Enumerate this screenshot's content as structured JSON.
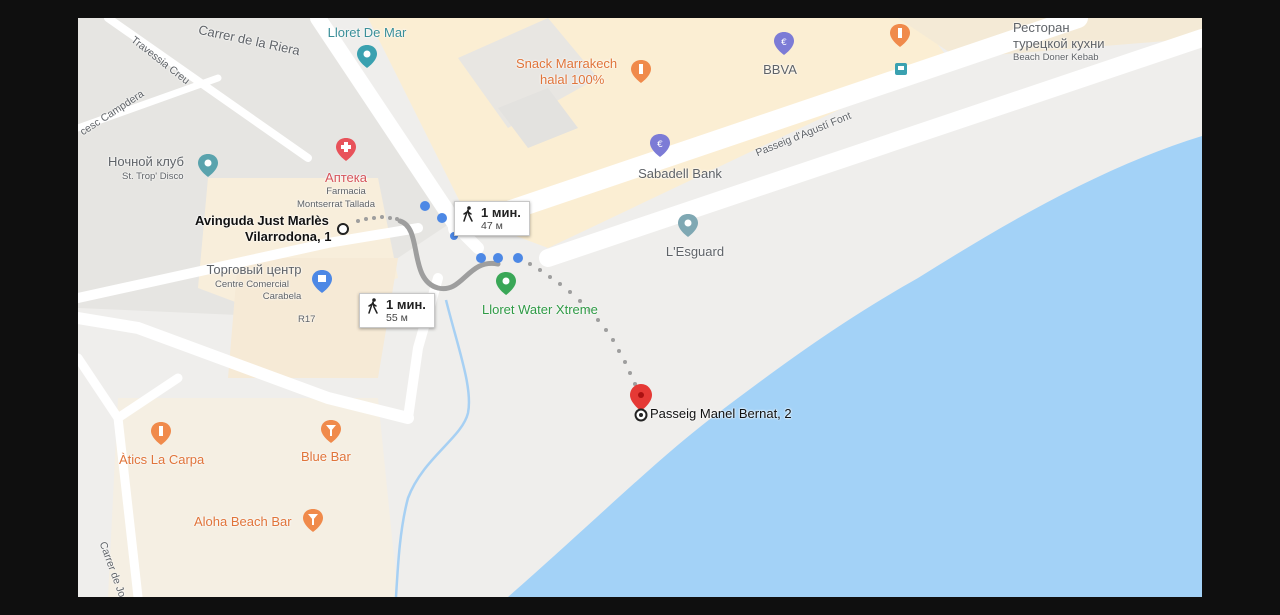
{
  "streets": {
    "carrer_de_la_riera": "Carrer de la Riera",
    "travessia_creu": "Travessia Creu",
    "cesc_campdera": "cesc Campdera",
    "passeig_agusti_font": "Passeig d'Agustí Font",
    "carrer_de_jo": "Carrer de Jo",
    "r17": "R17"
  },
  "places": {
    "lloret_de_mar": "Lloret De Mar",
    "snack_marrakech_line1": "Snack Marrakech",
    "snack_marrakech_line2": "halal 100%",
    "bbva": "BBVA",
    "restaurant_line1": "Ресторан",
    "restaurant_line2": "турецкой кухни",
    "restaurant_line3": "Beach Doner Kebab",
    "nightclub_line1": "Ночной клуб",
    "nightclub_line2": "St. Trop' Disco",
    "pharmacy_line1": "Аптека",
    "pharmacy_line2": "Farmacia",
    "pharmacy_line3": "Montserrat Tallada",
    "sabadell": "Sabadell Bank",
    "esguard": "L'Esguard",
    "mall_line1": "Торговый центр",
    "mall_line2": "Centre Comercial",
    "mall_line3": "Carabela",
    "water_xtreme": "Lloret Water Xtreme",
    "atics": "Àtics La Carpa",
    "blue_bar": "Blue Bar",
    "aloha": "Aloha Beach Bar"
  },
  "route": {
    "origin_line1": "Avinguda Just Marlès",
    "origin_line2": "Vilarrodona, 1",
    "destination": "Passeig Manel Bernat, 2",
    "callout_top": {
      "time": "1 мин.",
      "distance": "47 м"
    },
    "callout_bottom": {
      "time": "1 мин.",
      "distance": "55 м"
    }
  },
  "colors": {
    "water": "#a3d2f7",
    "route_selected": "#4d88e5",
    "route_alternative": "#9e9e9e",
    "destination_pin": "#e53935",
    "poi_food": "#f08a4b",
    "poi_bank": "#7c7bd6",
    "poi_park": "#3aa757",
    "poi_generic": "#5aa3ad",
    "poi_pharmacy": "#e8525a"
  }
}
